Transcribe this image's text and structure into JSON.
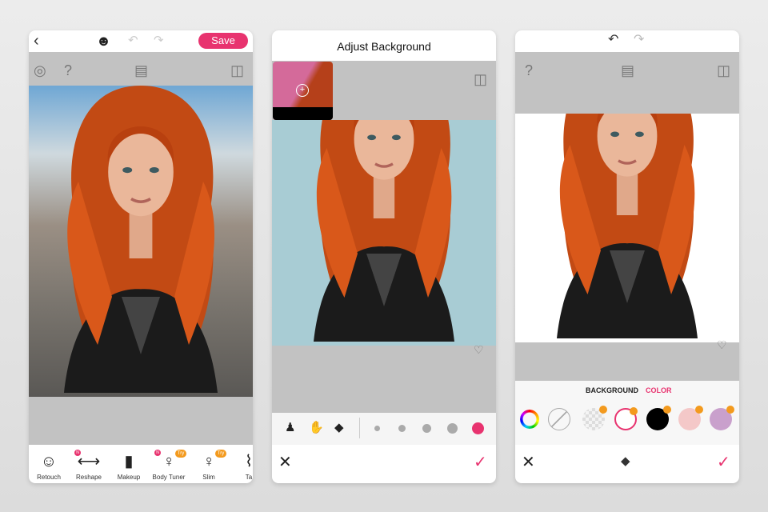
{
  "panel1": {
    "save_label": "Save",
    "tools": [
      {
        "label": "Retouch",
        "icon": "face-retouch-icon"
      },
      {
        "label": "Reshape",
        "icon": "reshape-icon",
        "new": "N"
      },
      {
        "label": "Makeup",
        "icon": "lipstick-icon"
      },
      {
        "label": "Body Tuner",
        "icon": "body-tuner-icon",
        "new": "N",
        "try": "Try"
      },
      {
        "label": "Slim",
        "icon": "slim-icon",
        "try": "Try"
      },
      {
        "label": "Ta",
        "icon": "tall-icon"
      }
    ]
  },
  "panel2": {
    "title": "Adjust Background",
    "brush_sizes": 5,
    "selected_brush_size": 5
  },
  "panel3": {
    "tabs": [
      "BACKGROUND",
      "COLOR"
    ],
    "active_tab": "COLOR",
    "colors": [
      "transparent",
      "#ffffff",
      "#000000",
      "#f4c8c8",
      "#c9a0cc"
    ],
    "selected_color": "#ffffff"
  },
  "colors": {
    "accent": "#e8336f",
    "toolbar": "#c2c2c2",
    "teal_bg": "#a8ccd4"
  }
}
